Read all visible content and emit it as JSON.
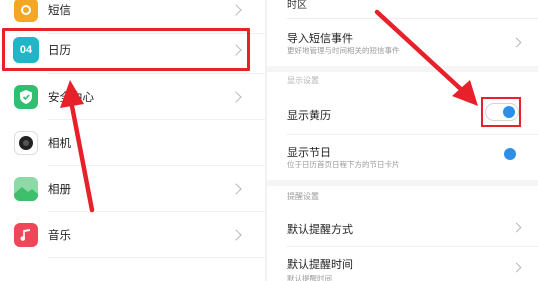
{
  "left": {
    "items": [
      {
        "label": "短信",
        "icon": "messages-icon",
        "color": "#f5a623"
      },
      {
        "label": "日历",
        "icon": "calendar-icon",
        "color": "#1fb6c7",
        "icon_text": "04"
      },
      {
        "label": "安全中心",
        "icon": "shield-icon",
        "color": "#2fbf71"
      },
      {
        "label": "相机",
        "icon": "camera-icon",
        "color": "#222222"
      },
      {
        "label": "相册",
        "icon": "gallery-icon",
        "color": "#3fbf6b"
      },
      {
        "label": "音乐",
        "icon": "music-icon",
        "color": "#f0465a"
      }
    ]
  },
  "right": {
    "top_item": "时区",
    "import_sms": {
      "title": "导入短信事件",
      "subtitle": "更好地管理与时间相关的短信事件"
    },
    "display_section": "显示设置",
    "show_almanac": {
      "title": "显示黄历",
      "enabled": true
    },
    "show_holidays": {
      "title": "显示节日",
      "subtitle": "位于日历首页日程下方的节日卡片",
      "enabled": true
    },
    "reminder_section": "提醒设置",
    "default_reminder_method": "默认提醒方式",
    "default_reminder_time": "默认提醒时间",
    "default_reminder_time_sub": "默认提醒时间"
  },
  "annotations": {
    "highlight_color": "#e8202a",
    "toggle_color": "#2f8ee8"
  }
}
